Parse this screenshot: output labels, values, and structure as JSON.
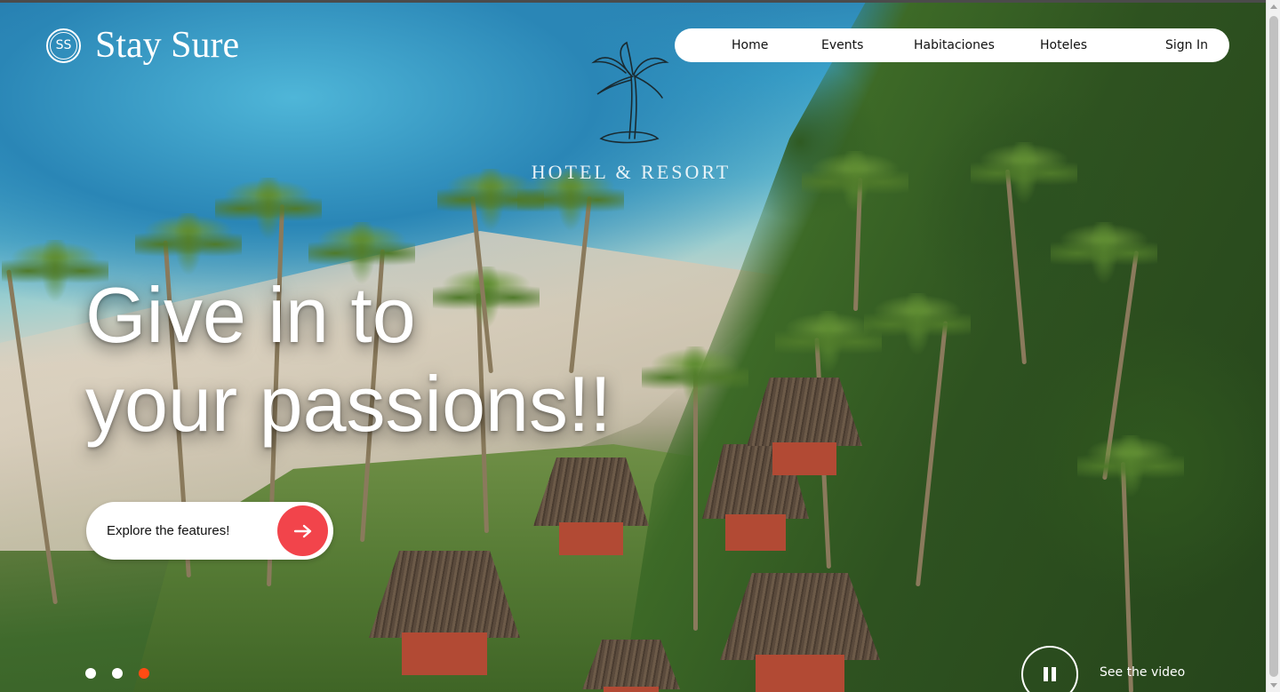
{
  "brand": {
    "logo_initials": "SS",
    "name": "Stay Sure"
  },
  "nav": {
    "items": [
      {
        "label": "Home"
      },
      {
        "label": "Events"
      },
      {
        "label": "Habitaciones"
      },
      {
        "label": "Hoteles"
      }
    ],
    "sign_in": "Sign In"
  },
  "emblem": {
    "text": "HOTEL & RESORT"
  },
  "hero": {
    "headline_line1": "Give in to",
    "headline_line2": "your passions!!",
    "cta_label": "Explore the features!"
  },
  "carousel": {
    "slide_count": 3,
    "active_index": 2,
    "dot_color": "#ffffff",
    "active_dot_color": "#ff4b13"
  },
  "video": {
    "label": "See the video",
    "state": "playing"
  },
  "colors": {
    "accent": "#f2444b",
    "nav_bg": "#ffffff"
  },
  "icons": {
    "cta": "arrow-right-icon",
    "video": "pause-icon",
    "emblem": "palm-tree-icon"
  }
}
